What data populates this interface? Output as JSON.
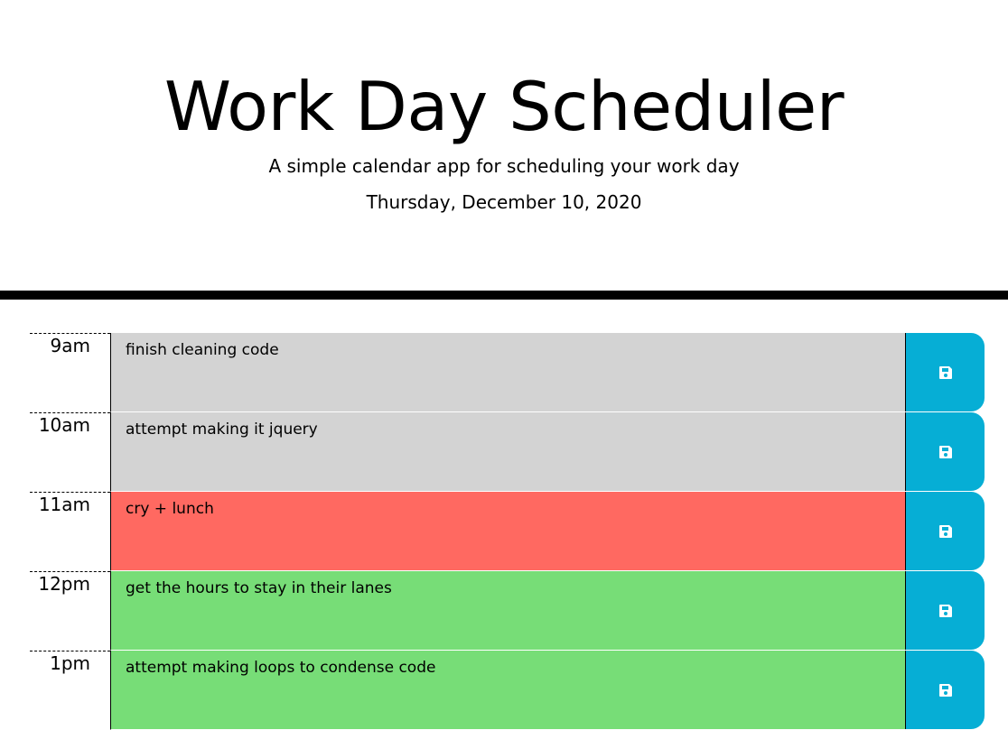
{
  "header": {
    "title": "Work Day Scheduler",
    "subtitle": "A simple calendar app for scheduling your work day",
    "date": "Thursday, December 10, 2020"
  },
  "colors": {
    "past": "#d3d3d3",
    "present": "#ff6961",
    "future": "#77dd77",
    "save": "#06aed5"
  },
  "rows": [
    {
      "hour": "9am",
      "text": "finish cleaning code",
      "state": "past",
      "save_icon": "floppy-disk-icon"
    },
    {
      "hour": "10am",
      "text": "attempt making it jquery",
      "state": "past",
      "save_icon": "floppy-disk-icon"
    },
    {
      "hour": "11am",
      "text": "cry + lunch",
      "state": "present",
      "save_icon": "floppy-disk-icon"
    },
    {
      "hour": "12pm",
      "text": "get the hours to stay in their lanes",
      "state": "future",
      "save_icon": "floppy-disk-icon"
    },
    {
      "hour": "1pm",
      "text": "attempt making loops to condense code",
      "state": "future",
      "save_icon": "floppy-disk-icon"
    }
  ]
}
